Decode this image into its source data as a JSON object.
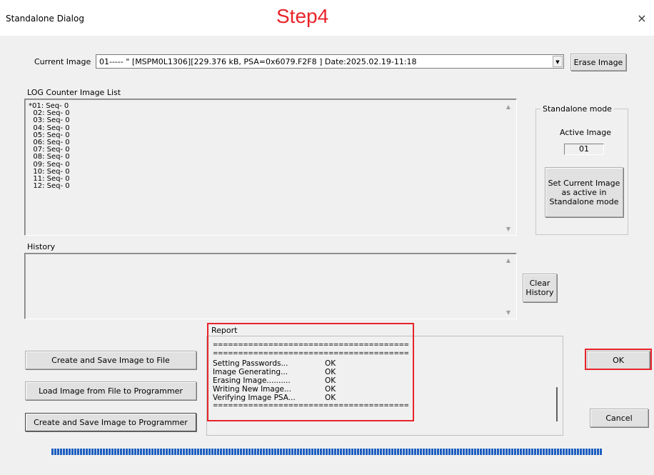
{
  "window": {
    "title": "Standalone Dialog",
    "annotation": "Step4",
    "close_glyph": "×"
  },
  "current_image": {
    "label": "Current Image",
    "value": "01----- \" [MSPM0L1306][229.376 kB, PSA=0x6079.F2F8 ] Date:2025.02.19-11:18",
    "dropdown_glyph": "▼",
    "erase_button": "Erase Image"
  },
  "log_counter": {
    "label": "LOG Counter Image List",
    "items": [
      "*01: Seq- 0",
      "  02: Seq- 0",
      "  03: Seq- 0",
      "  04: Seq- 0",
      "  05: Seq- 0",
      "  06: Seq- 0",
      "  07: Seq- 0",
      "  08: Seq- 0",
      "  09: Seq- 0",
      "  10: Seq- 0",
      "  11: Seq- 0",
      "  12: Seq- 0"
    ]
  },
  "standalone": {
    "group_title": "Standalone mode",
    "active_label": "Active Image",
    "active_value": "01",
    "set_button_line1": "Set Current Image",
    "set_button_line2": "as active in",
    "set_button_line3": "Standalone mode"
  },
  "history": {
    "label": "History",
    "clear_line1": "Clear",
    "clear_line2": "History"
  },
  "report": {
    "label": "Report",
    "separator": "==========================================",
    "lines": [
      {
        "text": "Setting Passwords...",
        "status": "OK"
      },
      {
        "text": "Image Generating...",
        "status": "OK"
      },
      {
        "text": "Erasing Image..........",
        "status": "OK"
      },
      {
        "text": "Writing New Image...",
        "status": "OK"
      },
      {
        "text": "Verifying Image PSA...",
        "status": "OK"
      }
    ]
  },
  "buttons": {
    "create_save_file": "Create and Save Image to File",
    "load_from_file": "Load Image from File to Programmer",
    "create_save_programmer": "Create and Save Image to Programmer",
    "ok": "OK",
    "cancel": "Cancel"
  },
  "progress": {
    "value": 1.0
  },
  "colors": {
    "annotation_red": "#e8232a",
    "progress_blue": "#1e5fc0"
  }
}
